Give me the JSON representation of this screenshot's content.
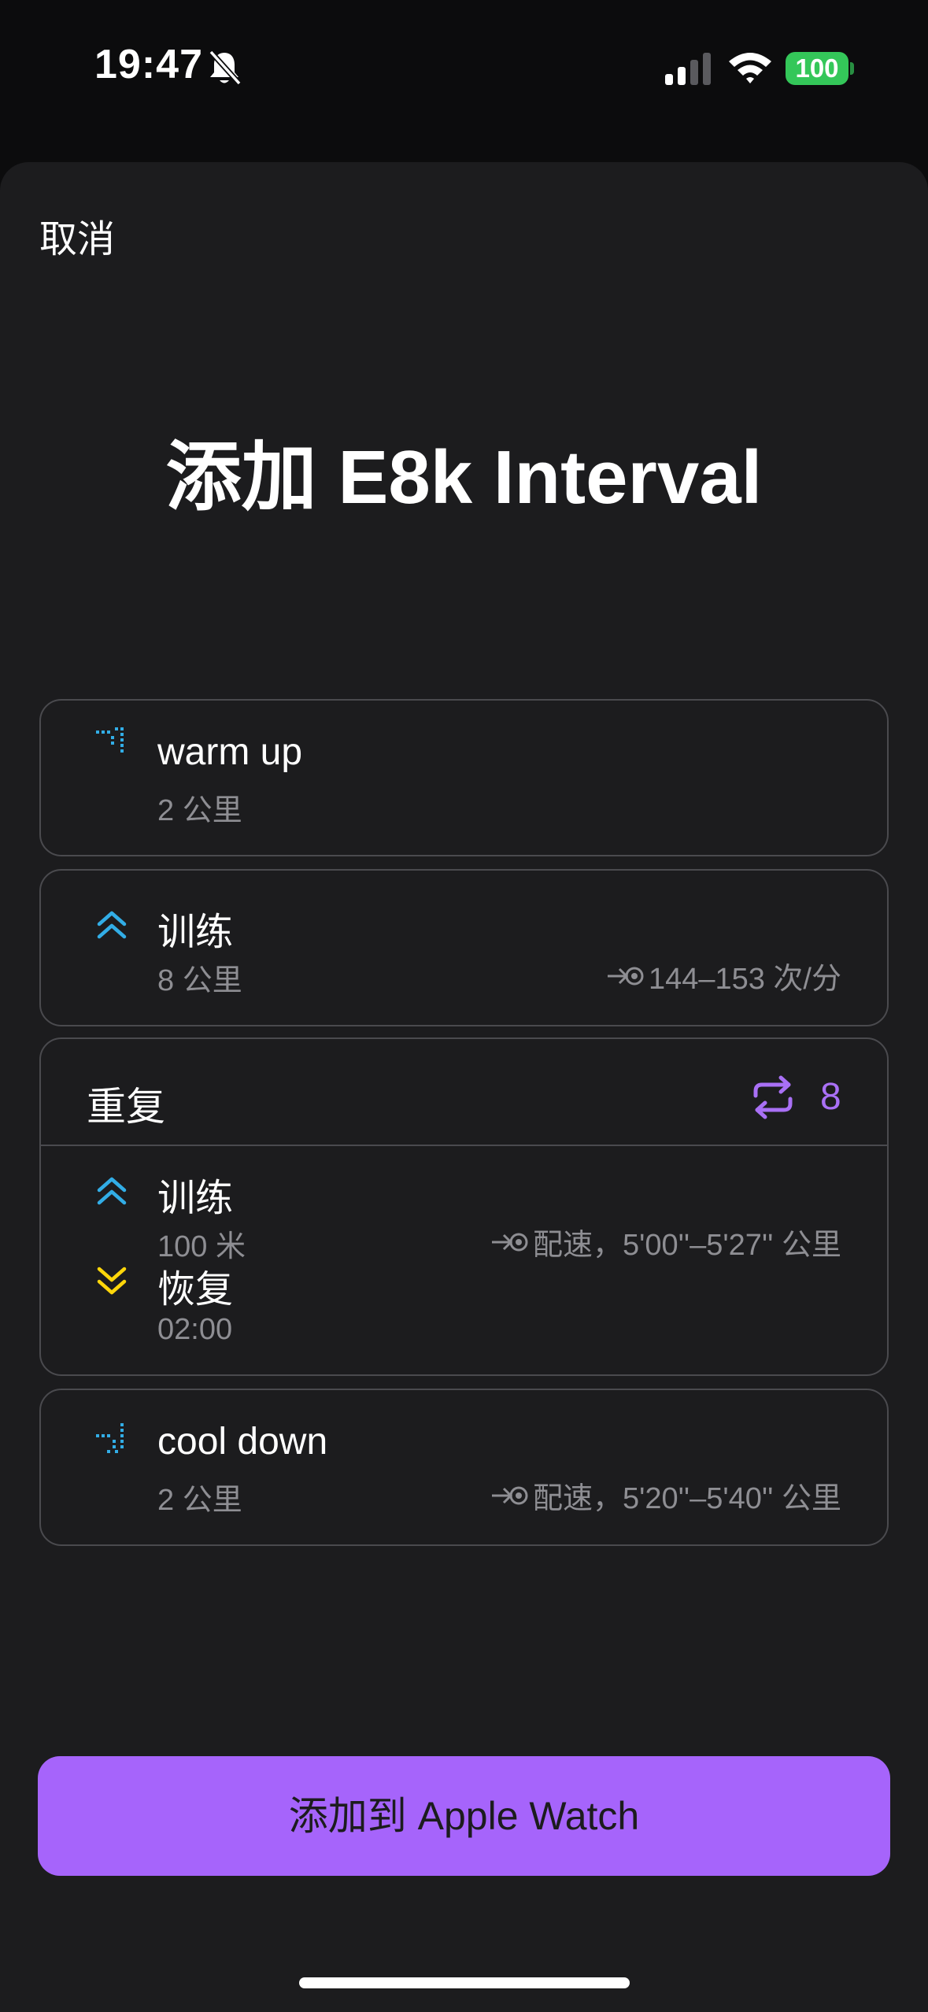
{
  "status_bar": {
    "time": "19:47",
    "battery": "100"
  },
  "sheet": {
    "cancel_label": "取消",
    "title": "添加 E8k Interval"
  },
  "steps": {
    "warmup": {
      "name": "warm up",
      "sub": "2 公里"
    },
    "train": {
      "name": "训练",
      "sub": "8 公里",
      "target": "144–153 次/分"
    },
    "repeat": {
      "label": "重复",
      "count": "8",
      "train": {
        "name": "训练",
        "sub": "100 米",
        "target": "配速，5'00''–5'27'' 公里"
      },
      "recover": {
        "name": "恢复",
        "sub": "02:00"
      }
    },
    "cooldown": {
      "name": "cool down",
      "sub": "2 公里",
      "target": "配速，5'20''–5'40'' 公里"
    }
  },
  "cta_label": "添加到 Apple Watch",
  "colors": {
    "accent": "#a664fb",
    "step_blue": "#32ade6",
    "recover_yellow": "#ffd60a",
    "sheet_bg": "#1c1c1e"
  }
}
